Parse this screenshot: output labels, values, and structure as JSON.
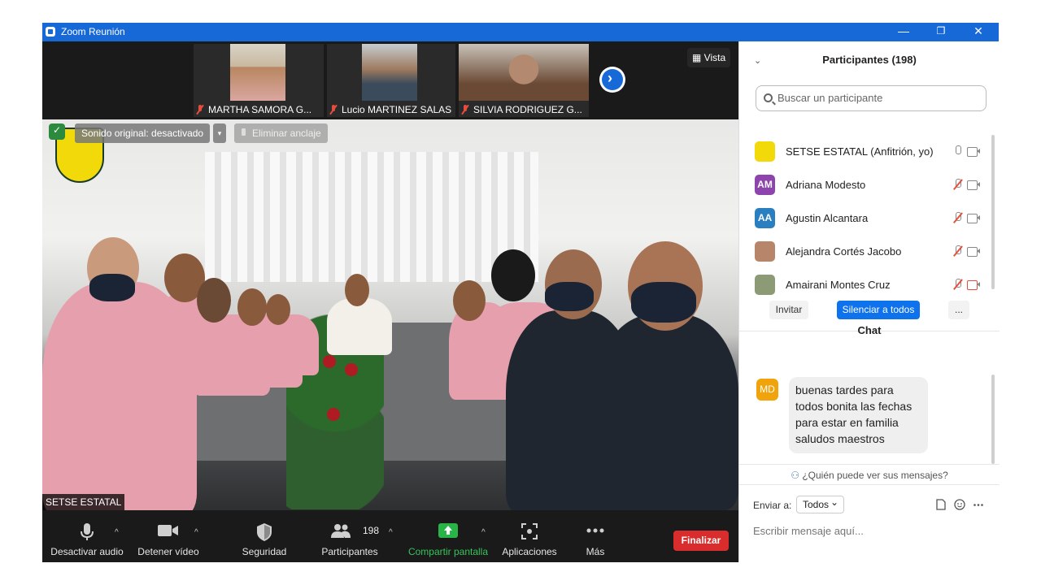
{
  "window": {
    "title": "Zoom Reunión",
    "minimize": "—",
    "restore": "❐",
    "close": "✕"
  },
  "strip": {
    "participants": [
      {
        "name": "MARTHA SAMORA G..."
      },
      {
        "name": "Lucio MARTINEZ SALAS"
      },
      {
        "name": "SILVIA RODRIGUEZ G..."
      }
    ],
    "next": "›",
    "view_label": "Vista"
  },
  "main_video": {
    "sound_label": "Sonido original: desactivado",
    "sound_caret": "▾",
    "unpin_label": "Eliminar anclaje",
    "speaker": "SETSE ESTATAL"
  },
  "toolbar": {
    "mute": "Desactivar audio",
    "video": "Detener vídeo",
    "security": "Seguridad",
    "participants": "Participantes",
    "participants_count": "198",
    "share": "Compartir pantalla",
    "apps": "Aplicaciones",
    "more": "Más",
    "end": "Finalizar",
    "caret": "^"
  },
  "participants_panel": {
    "title": "Participantes (198)",
    "search_placeholder": "Buscar un participante",
    "list": [
      {
        "name": "SETSE ESTATAL (Anfitrión, yo)",
        "initials": "",
        "color": "#f1d90a",
        "muted": false,
        "cam_off": false
      },
      {
        "name": "Adriana Modesto",
        "initials": "AM",
        "color": "#8e44ad",
        "muted": true,
        "cam_off": false
      },
      {
        "name": "Agustin Alcantara",
        "initials": "AA",
        "color": "#2a7fc1",
        "muted": true,
        "cam_off": false
      },
      {
        "name": "Alejandra Cortés Jacobo",
        "initials": "",
        "color": "#b7866a",
        "muted": true,
        "cam_off": false
      },
      {
        "name": "Amairani Montes Cruz",
        "initials": "",
        "color": "#8d9a76",
        "muted": true,
        "cam_off": true
      }
    ],
    "invite": "Invitar",
    "mute_all": "Silenciar a todos",
    "more": "..."
  },
  "chat": {
    "title": "Chat",
    "sender_initials": "MD",
    "message": "buenas tardes para todos bonita las fechas para estar en familia saludos maestros",
    "who_can_see": "¿Quién puede ver sus mensajes?",
    "send_to_label": "Enviar a:",
    "send_to_value": "Todos",
    "input_placeholder": "Escribir mensaje aquí..."
  },
  "colors": {
    "titlebar": "#1769d8",
    "mute_all": "#0e72ed",
    "end": "#d92c2c",
    "share": "#28b446"
  }
}
